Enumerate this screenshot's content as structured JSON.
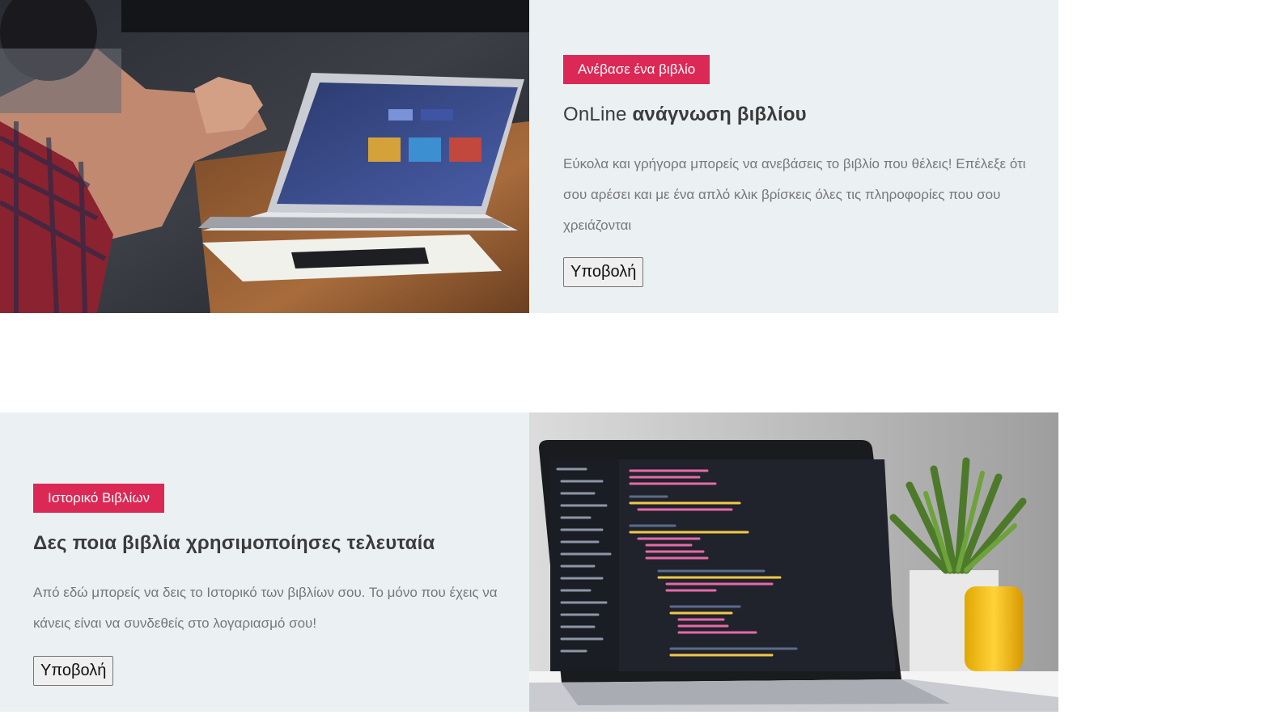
{
  "section_upload": {
    "image_alt": "People working on a laptop at a wooden table",
    "badge": "Ανέβασε ένα βιβλίο",
    "title_light": "OnLine",
    "title_bold": "ανάγνωση βιβλίου",
    "description": "Εύκολα και γρήγορα μπορείς να ανεβάσεις το βιβλίο που θέλεις! Επέλεξε ότι σου αρέσει και με ένα απλό κλικ βρίσκεις όλες τις πληροφορίες που σου χρειάζονται",
    "button": "Υποβολή"
  },
  "section_history": {
    "badge": "Ιστορικό Βιβλίων",
    "title_bold": "Δες ποια βιβλία χρησιμοποίησες τελευταία",
    "description": "Από εδώ μπορείς να δεις το Ιστορικό των βιβλίων σου. Το μόνο που έχεις να κάνεις είναι να συνδεθείς στο λογαριασμό σου!",
    "button": "Υποβολή",
    "image_alt": "Laptop showing code editor next to a plant and yellow mug"
  },
  "colors": {
    "accent": "#dc2855",
    "panel_bg": "#ebf1f3",
    "heading": "#3b3b3b",
    "body_text": "#777777"
  }
}
